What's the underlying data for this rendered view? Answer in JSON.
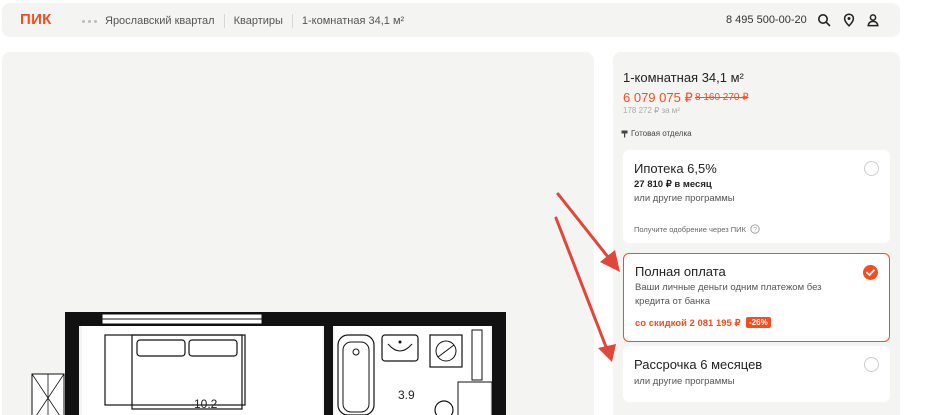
{
  "header": {
    "logo": "ПИК",
    "breadcrumbs": [
      "Ярославский квартал",
      "Квартиры",
      "1-комнатная 34,1 м²"
    ],
    "phone": "8 495 500-00-20",
    "icons": [
      "search-icon",
      "location-pin-icon",
      "user-icon"
    ]
  },
  "plan": {
    "rooms": [
      "10.2",
      "3.9"
    ]
  },
  "panel": {
    "title": "1-комнатная 34,1 м²",
    "price": "6 079 075 ₽",
    "old_price": "8 160 270 ₽",
    "price_per_m2": "178 272 ₽ за м²",
    "finish": "Готовая отделка",
    "options": [
      {
        "title": "Ипотека 6,5%",
        "monthly": "27 810 ₽ в месяц",
        "other": "или другие программы",
        "note": "Получите одобрение через ПИК",
        "selected": false
      },
      {
        "title": "Полная оплата",
        "description": "Ваши личные деньги одним платежом без кредита от банка",
        "discount": "со скидкой 2 081 195 ₽",
        "badge": "-26%",
        "selected": true
      },
      {
        "title": "Рассрочка 6 месяцев",
        "other": "или другие программы",
        "selected": false
      }
    ]
  },
  "colors": {
    "accent": "#fa4b1e",
    "arrow": "#e0463a",
    "panel_bg": "#f4f4f2"
  }
}
